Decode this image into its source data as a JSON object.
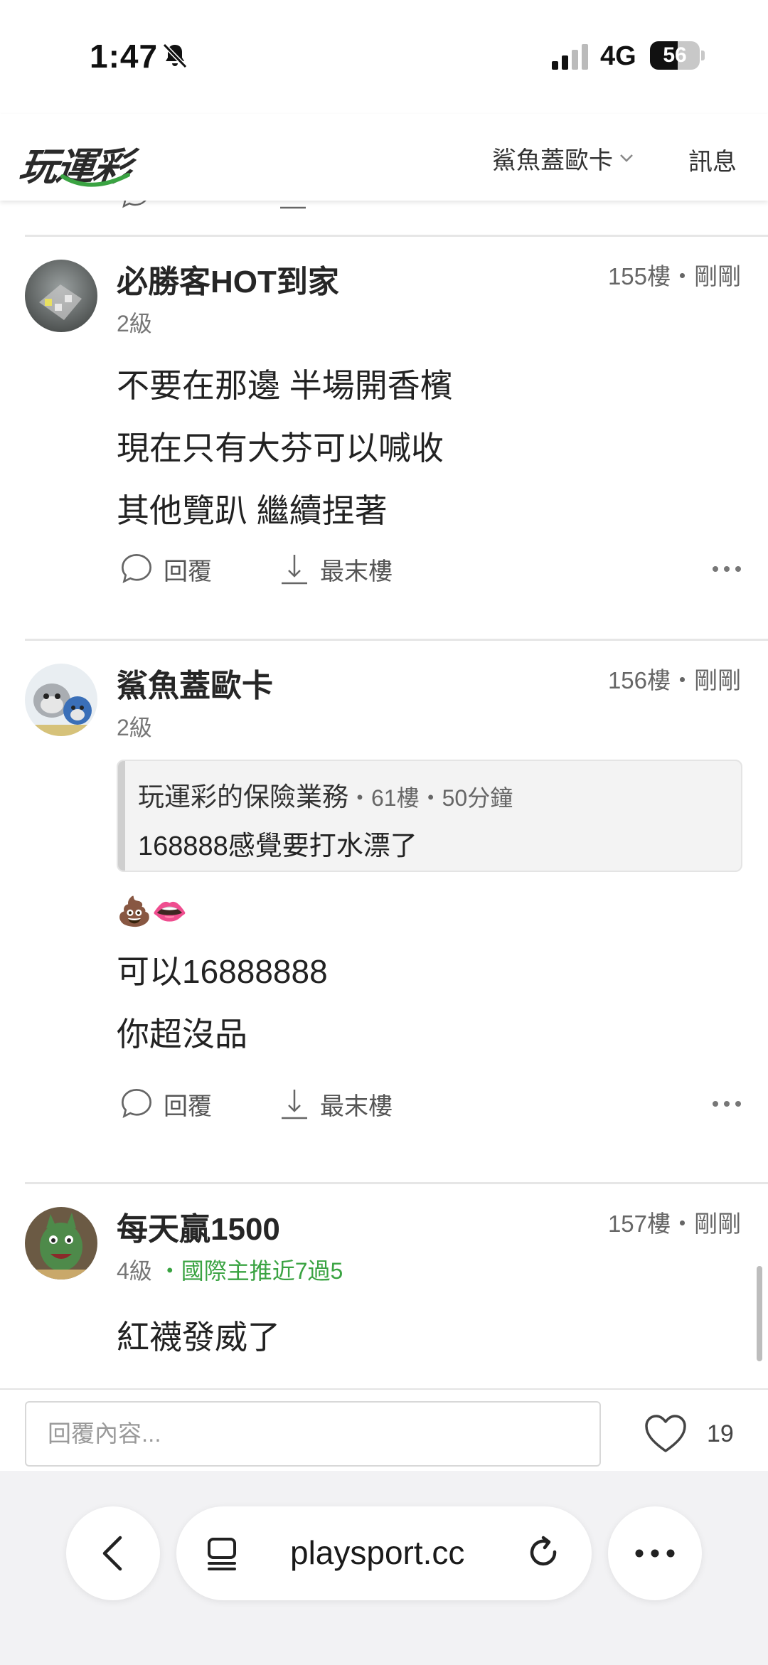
{
  "status_bar": {
    "time": "1:47",
    "network": "4G",
    "battery": "56",
    "battery_level": 0.56
  },
  "header": {
    "logo": "玩運彩",
    "user_menu": "鯊魚蓋歐卡",
    "messages": "訊息"
  },
  "posts": [
    {
      "author": "必勝客HOT到家",
      "floor": "155樓・剛剛",
      "level": "2級",
      "lines": [
        "不要在那邊 半場開香檳",
        "現在只有大芬可以喊收",
        "其他覽趴 繼續捏著"
      ],
      "reply_label": "回覆",
      "last_floor_label": "最末樓"
    },
    {
      "author": "鯊魚蓋歐卡",
      "floor": "156樓・剛剛",
      "level": "2級",
      "quote": {
        "author": "玩運彩的保險業務",
        "meta": "・61樓・50分鐘",
        "text": "168888感覺要打水漂了"
      },
      "emoji_line": "💩👄",
      "lines": [
        "可以16888888",
        "你超沒品"
      ],
      "reply_label": "回覆",
      "last_floor_label": "最末樓"
    },
    {
      "author": "每天贏1500",
      "floor": "157樓・剛剛",
      "level": "4級",
      "badge": "・國際主推近7過5",
      "lines": [
        "紅襪發威了"
      ]
    }
  ],
  "reply_bar": {
    "placeholder": "回覆內容...",
    "like_count": "19"
  },
  "browser": {
    "url": "playsport.cc"
  },
  "colors": {
    "badge_green": "#3aa342",
    "logo_green": "#3aa342",
    "divider": "#e6e6e6"
  }
}
